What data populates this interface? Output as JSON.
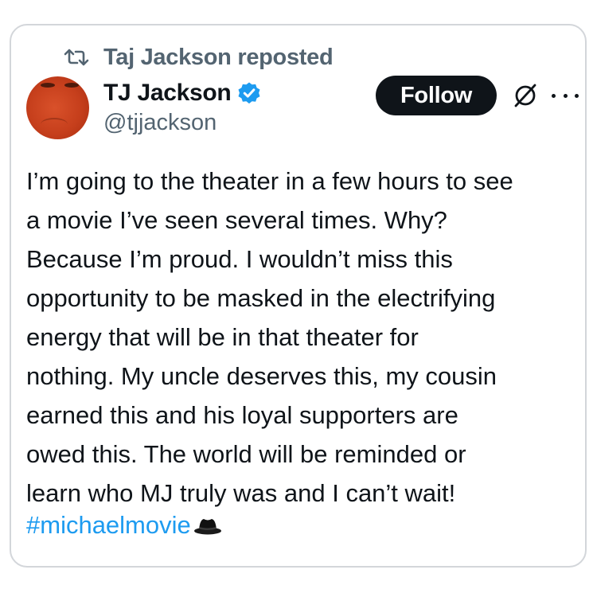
{
  "repost": {
    "text": "Taj Jackson reposted",
    "icon": "repost-icon"
  },
  "author": {
    "name": "TJ Jackson",
    "handle": "@tjjackson",
    "verified": true,
    "verified_color": "#1d9bf0"
  },
  "actions": {
    "follow_label": "Follow",
    "grok_icon": "grok-icon",
    "more_icon": "more-icon"
  },
  "tweet": {
    "text": "I’m going to the theater in a few hours to see\na movie I’ve seen several times. Why?\nBecause I’m proud. I wouldn’t miss this\nopportunity to be masked in the electrifying\nenergy that will be in that theater for\nnothing. My uncle deserves this, my cousin\nearned this and his loyal supporters are\nowed this. The world will be reminded or\nlearn who MJ truly was and I can’t wait!",
    "hashtag": "#michaelmovie",
    "emoji_icon": "fedora-hat-icon"
  },
  "colors": {
    "link": "#1d9bf0",
    "secondary_text": "#536471",
    "primary_text": "#0f1419",
    "follow_bg": "#0f1419"
  }
}
